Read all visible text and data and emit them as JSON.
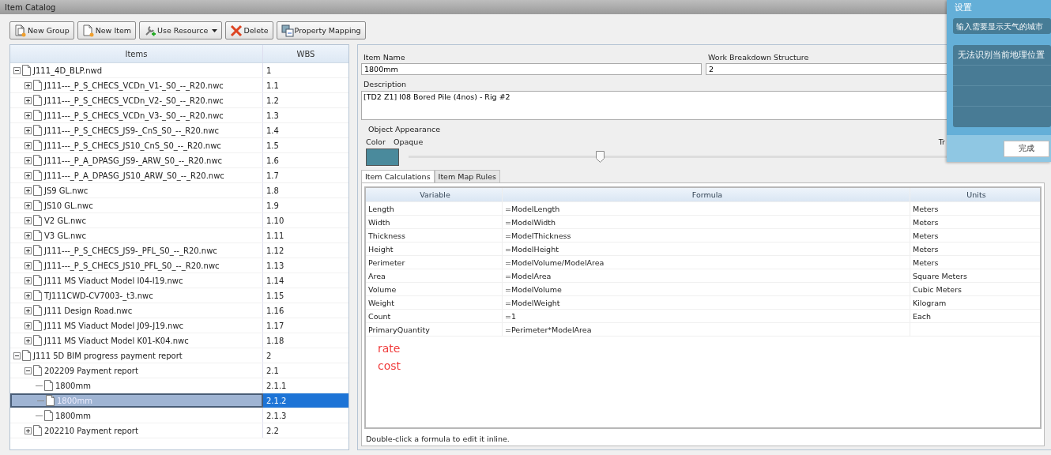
{
  "window": {
    "title": "Item Catalog"
  },
  "toolbar": [
    {
      "kind": "group",
      "label": "New Group"
    },
    {
      "kind": "item",
      "label": "New Item"
    },
    {
      "kind": "resource",
      "label": "Use Resource",
      "dropdown": true
    },
    {
      "kind": "delete",
      "label": "Delete"
    },
    {
      "kind": "mapping",
      "label": "Property Mapping"
    }
  ],
  "tree": {
    "columns": [
      "Items",
      "WBS"
    ],
    "items": [
      {
        "label": "J111_4D_BLP.nwd",
        "wbs": "1",
        "expanded": true,
        "selected": false,
        "children": [
          {
            "label": "J111---_P_S_CHECS_VCDn_V1-_S0_--_R20.nwc",
            "wbs": "1.1",
            "expanded": false,
            "selected": false
          },
          {
            "label": "J111---_P_S_CHECS_VCDn_V2-_S0_--_R20.nwc",
            "wbs": "1.2",
            "expanded": false,
            "selected": false
          },
          {
            "label": "J111---_P_S_CHECS_VCDn_V3-_S0_--_R20.nwc",
            "wbs": "1.3",
            "expanded": false,
            "selected": false
          },
          {
            "label": "J111---_P_S_CHECS_JS9-_CnS_S0_--_R20.nwc",
            "wbs": "1.4",
            "expanded": false,
            "selected": false
          },
          {
            "label": "J111---_P_S_CHECS_JS10_CnS_S0_--_R20.nwc",
            "wbs": "1.5",
            "expanded": false,
            "selected": false
          },
          {
            "label": "J111---_P_A_DPASG_JS9-_ARW_S0_--_R20.nwc",
            "wbs": "1.6",
            "expanded": false,
            "selected": false
          },
          {
            "label": "J111---_P_A_DPASG_JS10_ARW_S0_--_R20.nwc",
            "wbs": "1.7",
            "expanded": false,
            "selected": false
          },
          {
            "label": "JS9 GL.nwc",
            "wbs": "1.8",
            "expanded": false,
            "selected": false
          },
          {
            "label": "JS10 GL.nwc",
            "wbs": "1.9",
            "expanded": false,
            "selected": false
          },
          {
            "label": "V2 GL.nwc",
            "wbs": "1.10",
            "expanded": false,
            "selected": false
          },
          {
            "label": "V3 GL.nwc",
            "wbs": "1.11",
            "expanded": false,
            "selected": false
          },
          {
            "label": "J111---_P_S_CHECS_JS9-_PFL_S0_--_R20.nwc",
            "wbs": "1.12",
            "expanded": false,
            "selected": false
          },
          {
            "label": "J111---_P_S_CHECS_JS10_PFL_S0_--_R20.nwc",
            "wbs": "1.13",
            "expanded": false,
            "selected": false
          },
          {
            "label": "J111 MS Viaduct Model I04-I19.nwc",
            "wbs": "1.14",
            "expanded": false,
            "selected": false
          },
          {
            "label": "TJ111CWD-CV7003-_t3.nwc",
            "wbs": "1.15",
            "expanded": false,
            "selected": false
          },
          {
            "label": "J111 Design Road.nwc",
            "wbs": "1.16",
            "expanded": false,
            "selected": false
          },
          {
            "label": "J111  MS  Viaduct Model J09-J19.nwc",
            "wbs": "1.17",
            "expanded": false,
            "selected": false
          },
          {
            "label": "J111  MS  Viaduct Model K01-K04.nwc",
            "wbs": "1.18",
            "expanded": false,
            "selected": false
          }
        ]
      },
      {
        "label": "J111 5D BIM progress payment report",
        "wbs": "2",
        "expanded": true,
        "selected": false,
        "children": [
          {
            "label": "202209 Payment report",
            "wbs": "2.1",
            "expanded": true,
            "selected": false,
            "children": [
              {
                "label": "1800mm",
                "wbs": "2.1.1",
                "selected": false
              },
              {
                "label": "1800mm",
                "wbs": "2.1.2",
                "selected": true
              },
              {
                "label": "1800mm",
                "wbs": "2.1.3",
                "selected": false
              }
            ]
          },
          {
            "label": "202210 Payment report",
            "wbs": "2.2",
            "expanded": false,
            "selected": false
          }
        ]
      }
    ]
  },
  "details": {
    "item_name": {
      "label": "Item Name",
      "value": "1800mm"
    },
    "wbs": {
      "label": "Work Breakdown Structure",
      "value": "2"
    },
    "description": {
      "label": "Description",
      "value": "[TD2 Z1] I08 Bored Pile (4nos) - Rig #2"
    },
    "appearance": {
      "title": "Object Appearance",
      "color_label": "Color",
      "color": "#4a8a9c",
      "opaque_label": "Opaque",
      "transparent_label": "Tr",
      "level": 0.3
    }
  },
  "tabs": [
    {
      "label": "Item Calculations",
      "selected": true
    },
    {
      "label": "Item Map Rules",
      "selected": false
    }
  ],
  "calculations": {
    "columns": [
      "Variable",
      "Formula",
      "Units"
    ],
    "rows": [
      [
        "Length",
        "=ModelLength",
        "Meters"
      ],
      [
        "Width",
        "=ModelWidth",
        "Meters"
      ],
      [
        "Thickness",
        "=ModelThickness",
        "Meters"
      ],
      [
        "Height",
        "=ModelHeight",
        "Meters"
      ],
      [
        "Perimeter",
        "=ModelVolume/ModelArea",
        "Meters"
      ],
      [
        "Area",
        "=ModelArea",
        "Square Meters"
      ],
      [
        "Volume",
        "=ModelVolume",
        "Cubic Meters"
      ],
      [
        "Weight",
        "=ModelWeight",
        "Kilogram"
      ],
      [
        "Count",
        "=1",
        "Each"
      ],
      [
        "PrimaryQuantity",
        "=Perimeter*ModelArea",
        ""
      ]
    ],
    "annotations": [
      "rate",
      "cost"
    ],
    "hint": "Double-click a formula to edit it inline."
  },
  "settings_popup": {
    "title": "设置",
    "city_placeholder": "输入需要显示天气的城市",
    "location_message": "无法识别当前地理位置",
    "done_button": "完成"
  }
}
